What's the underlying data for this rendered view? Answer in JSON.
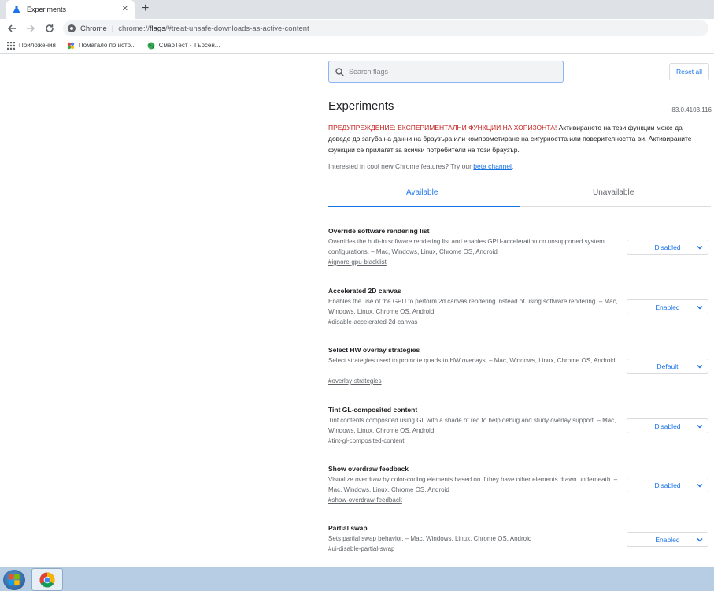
{
  "browser": {
    "tab_title": "Experiments",
    "url_chip": "Chrome",
    "url_prefix": "chrome://",
    "url_host": "flags",
    "url_rest": "/#treat-unsafe-downloads-as-active-content"
  },
  "bookmarks": [
    {
      "label": "Приложения"
    },
    {
      "label": "Помагало по исто..."
    },
    {
      "label": "СмарТест - Търсен..."
    }
  ],
  "search": {
    "placeholder": "Search flags"
  },
  "reset_label": "Reset all",
  "page_title": "Experiments",
  "version": "83.0.4103.116",
  "warning": {
    "red": "ПРЕДУПРЕЖДЕНИЕ: ЕКСПЕРИМЕНТАЛНИ ФУНКЦИИ НА ХОРИЗОНТА!",
    "rest": " Активирането на тези функции може да доведе до загуба на данни на браузъра или компрометиране на сигурността или поверителността ви. Активираните функции се прилагат за всички потребители на този браузър."
  },
  "promo": {
    "text": "Interested in cool new Chrome features? Try our ",
    "link": "beta channel",
    "suffix": "."
  },
  "tabs": {
    "available": "Available",
    "unavailable": "Unavailable"
  },
  "flags": [
    {
      "name": "Override software rendering list",
      "desc": "Overrides the built-in software rendering list and enables GPU-acceleration on unsupported system configurations. – Mac, Windows, Linux, Chrome OS, Android",
      "link": "#ignore-gpu-blacklist",
      "value": "Disabled"
    },
    {
      "name": "Accelerated 2D canvas",
      "desc": "Enables the use of the GPU to perform 2d canvas rendering instead of using software rendering. – Mac, Windows, Linux, Chrome OS, Android",
      "link": "#disable-accelerated-2d-canvas",
      "value": "Enabled"
    },
    {
      "name": "Select HW overlay strategies",
      "desc": "Select strategies used to promote quads to HW overlays. – Mac, Windows, Linux, Chrome OS, Android",
      "link": "#overlay-strategies",
      "value": "Default"
    },
    {
      "name": "Tint GL-composited content",
      "desc": "Tint contents composited using GL with a shade of red to help debug and study overlay support. – Mac, Windows, Linux, Chrome OS, Android",
      "link": "#tint-gl-composited-content",
      "value": "Disabled"
    },
    {
      "name": "Show overdraw feedback",
      "desc": "Visualize overdraw by color-coding elements based on if they have other elements drawn underneath. – Mac, Windows, Linux, Chrome OS, Android",
      "link": "#show-overdraw-feedback",
      "value": "Disabled"
    },
    {
      "name": "Partial swap",
      "desc": "Sets partial swap behavior. – Mac, Windows, Linux, Chrome OS, Android",
      "link": "#ui-disable-partial-swap",
      "value": "Enabled"
    }
  ]
}
